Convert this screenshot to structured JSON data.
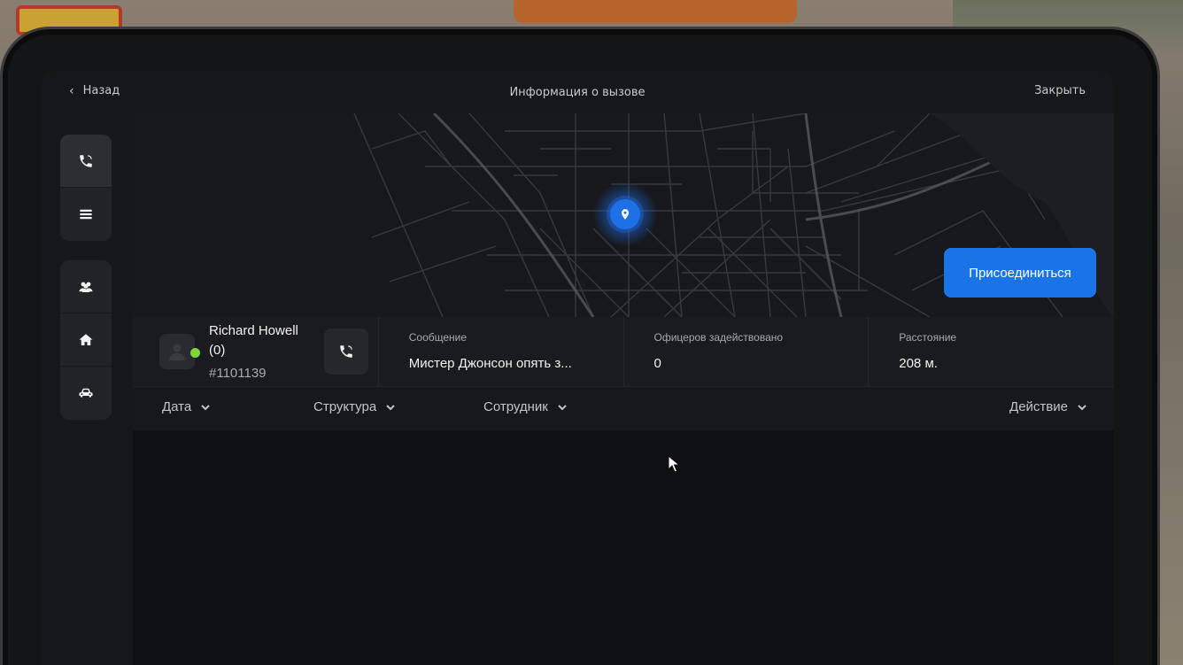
{
  "topbar": {
    "back_label": "Назад",
    "title": "Информация о вызове",
    "close_label": "Закрыть"
  },
  "sidebar": {
    "group1": [
      {
        "icon": "phone-icon",
        "active": true
      },
      {
        "icon": "menu-icon",
        "active": false
      }
    ],
    "group2": [
      {
        "icon": "users-icon",
        "active": false
      },
      {
        "icon": "home-icon",
        "active": false
      },
      {
        "icon": "car-icon",
        "active": false
      }
    ]
  },
  "map": {
    "join_label": "Присоединиться",
    "accent_color": "#1a74e8"
  },
  "caller": {
    "name": "Richard Howell",
    "count": "(0)",
    "id": "#1101139",
    "status_color": "#7ad83a"
  },
  "stats": [
    {
      "label": "Сообщение",
      "value": "Мистер Джонсон опять з..."
    },
    {
      "label": "Офицеров задействовано",
      "value": "0"
    },
    {
      "label": "Расстояние",
      "value": "208 м."
    }
  ],
  "table": {
    "columns": [
      "Дата",
      "Структура",
      "Сотрудник",
      "Действие"
    ]
  }
}
